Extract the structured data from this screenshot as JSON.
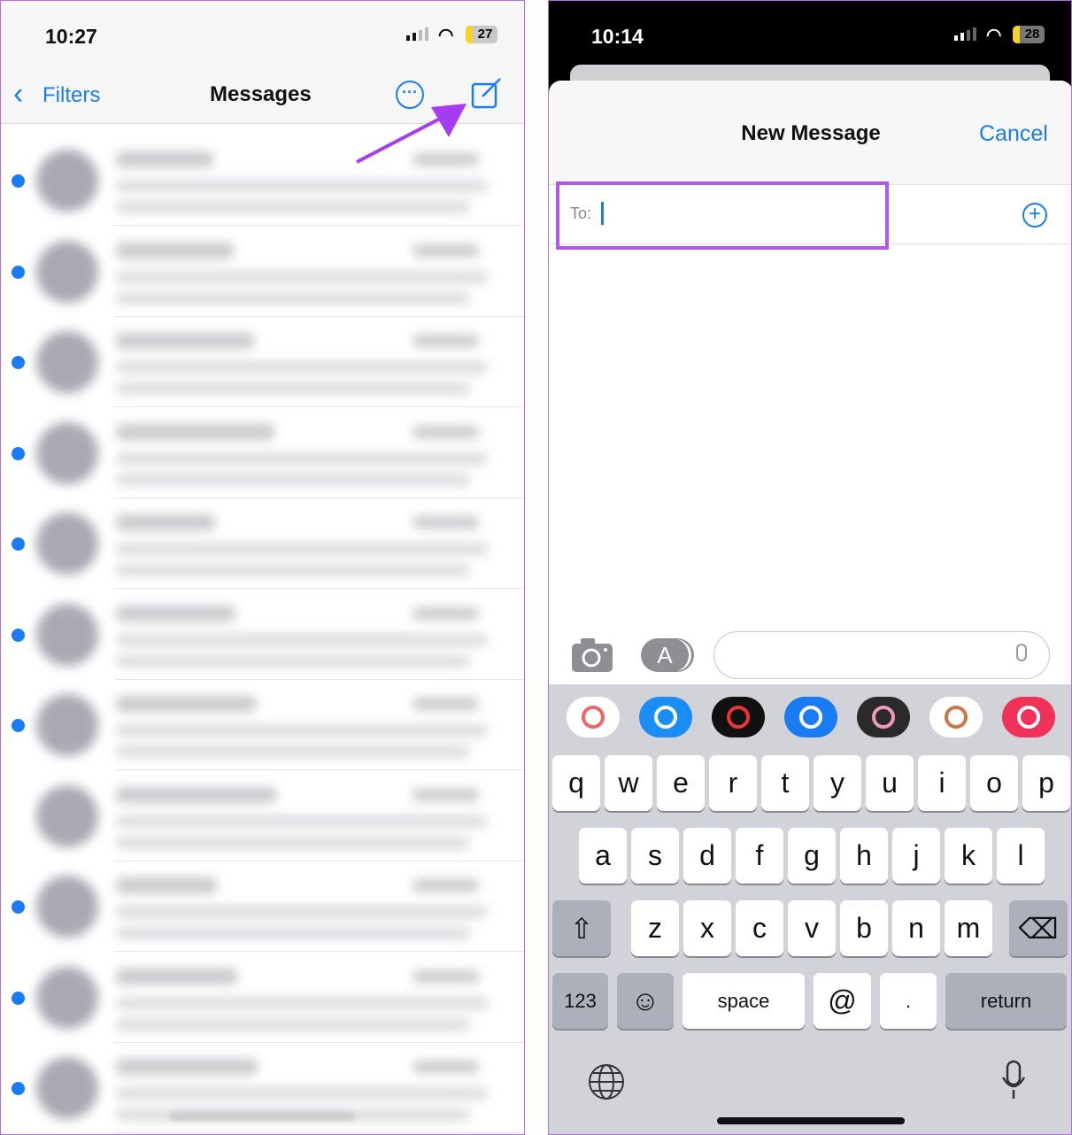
{
  "left": {
    "status": {
      "time": "10:27",
      "battery": "27"
    },
    "nav": {
      "back": "Filters",
      "title": "Messages",
      "more_icon": "ellipsis-circle-icon",
      "compose_icon": "compose-icon"
    },
    "unread_rows": [
      true,
      true,
      true,
      true,
      true,
      true,
      true,
      false,
      true,
      true,
      true
    ],
    "annotation_color": "#a53cf0"
  },
  "right": {
    "status": {
      "time": "10:14",
      "battery": "28"
    },
    "header": {
      "title": "New Message",
      "cancel": "Cancel"
    },
    "to_label": "To:",
    "highlight_color": "#b157f0",
    "keyboard": {
      "row1": [
        "q",
        "w",
        "e",
        "r",
        "t",
        "y",
        "u",
        "i",
        "o",
        "p"
      ],
      "row2": [
        "a",
        "s",
        "d",
        "f",
        "g",
        "h",
        "j",
        "k",
        "l"
      ],
      "row3": [
        "z",
        "x",
        "c",
        "v",
        "b",
        "n",
        "m"
      ],
      "numbers": "123",
      "space": "space",
      "at": "@",
      "period": ".",
      "return": "return"
    },
    "apps": [
      "photos",
      "app-store",
      "activity",
      "audio-message",
      "memoji",
      "memoji-stickers",
      "search-images"
    ]
  }
}
